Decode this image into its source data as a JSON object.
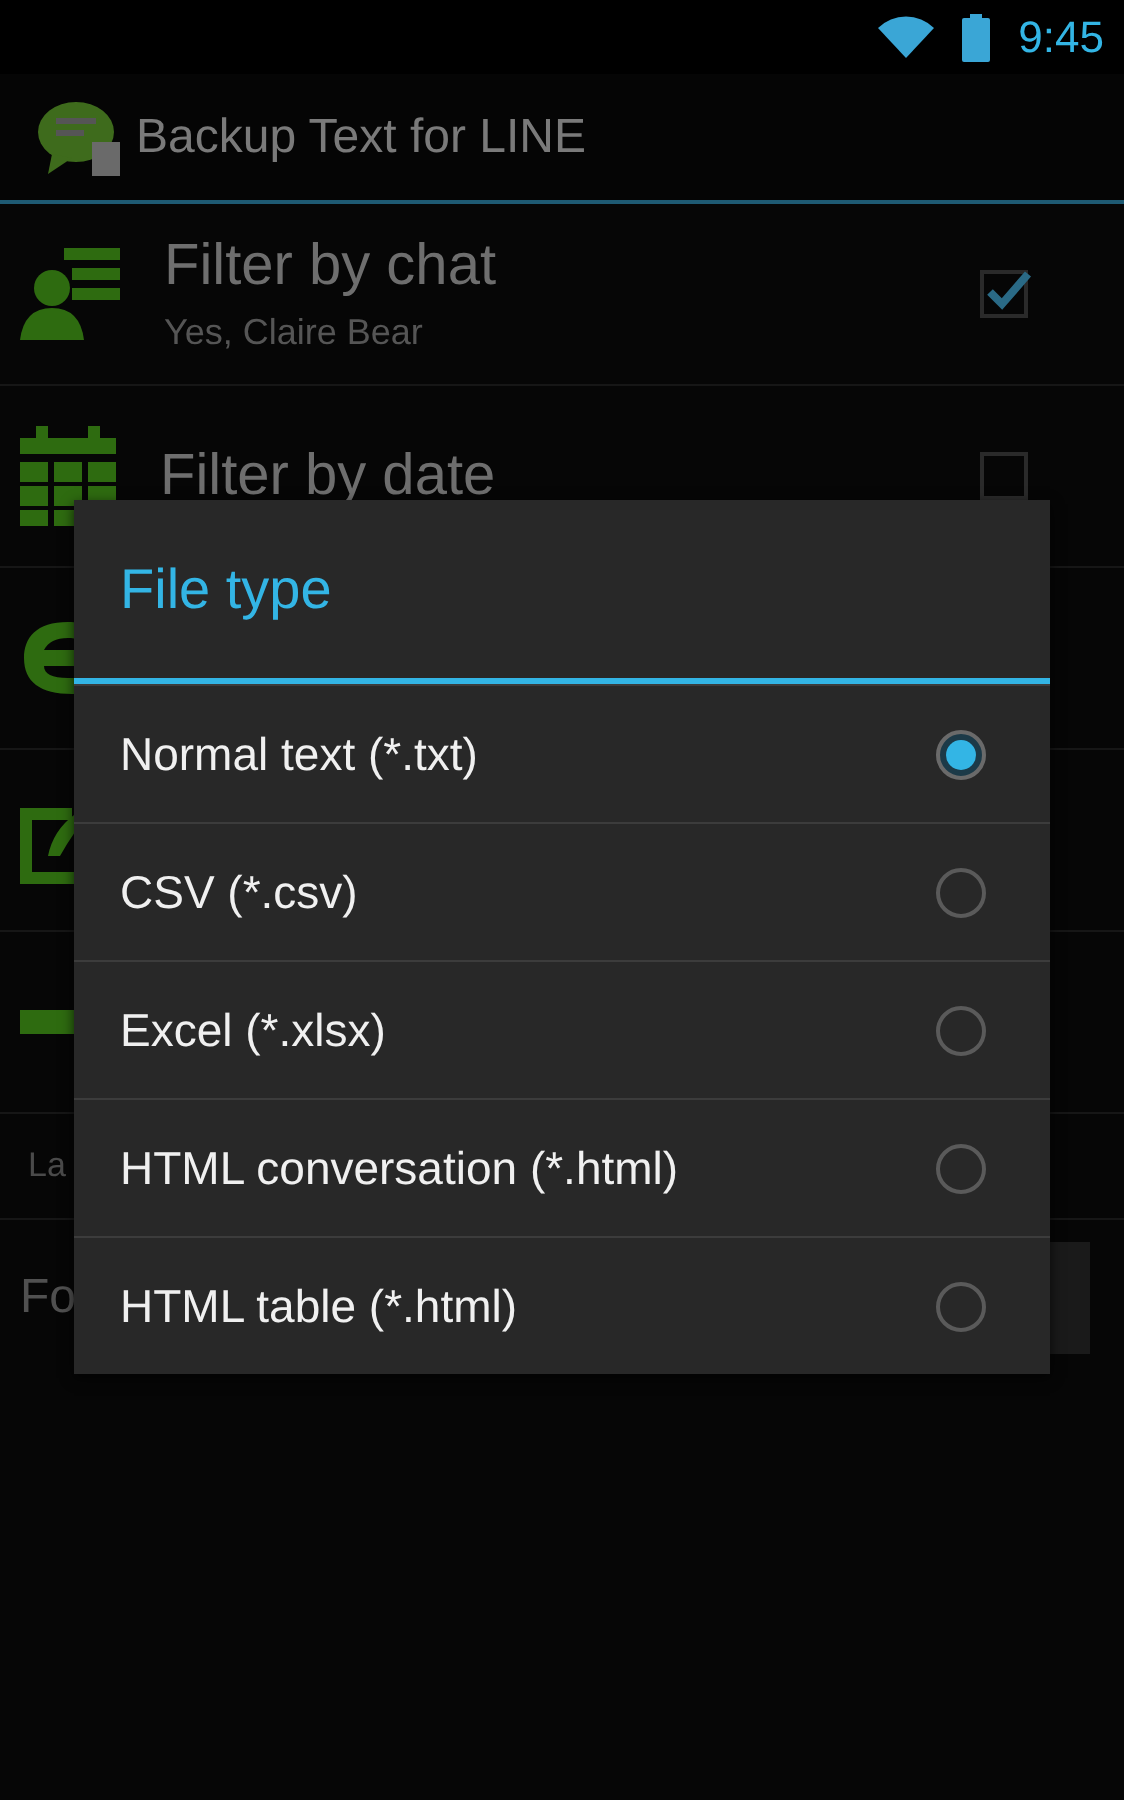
{
  "status_bar": {
    "time": "9:45"
  },
  "app_bar": {
    "title": "Backup Text for LINE"
  },
  "settings": [
    {
      "title": "Filter by chat",
      "summary": "Yes, Claire Bear",
      "checked": true
    },
    {
      "title": "Filter by date",
      "checked": false
    }
  ],
  "label_row": {
    "text": "La"
  },
  "field_row": {
    "text": "Fo"
  },
  "dialog": {
    "title": "File type",
    "options": [
      {
        "label": "Normal text (*.txt)",
        "selected": true
      },
      {
        "label": "CSV (*.csv)",
        "selected": false
      },
      {
        "label": "Excel (*.xlsx)",
        "selected": false
      },
      {
        "label": "HTML conversation (*.html)",
        "selected": false
      },
      {
        "label": "HTML table (*.html)",
        "selected": false
      }
    ]
  }
}
